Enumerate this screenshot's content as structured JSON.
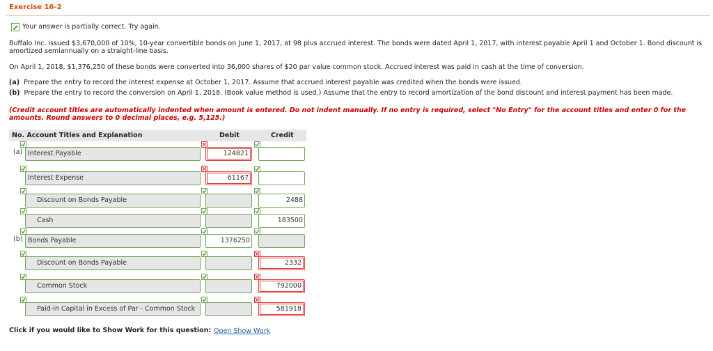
{
  "exercise_title": "Exercise 16-2",
  "status_text": "Your answer is partially correct.  Try again.",
  "problem_text": "Buffalo Inc. issued $3,670,000 of 10%, 10-year convertible bonds on June 1, 2017, at 98 plus accrued interest. The bonds were dated April 1, 2017, with interest payable April 1 and October 1. Bond discount is amortized semiannually on a straight-line basis.",
  "conversion_text": "On April 1, 2018, $1,376,250 of these bonds were converted into 36,000 shares of $20 par value common stock. Accrued interest was paid in cash at the time of conversion.",
  "part_a": {
    "label": "(a)",
    "text": "Prepare the entry to record the interest expense at October 1, 2017. Assume that accrued interest payable was credited when the bonds were issued."
  },
  "part_b": {
    "label": "(b)",
    "text": "Prepare the entry to record the conversion on April 1, 2018. (Book value method is used.) Assume that the entry to record amortization of the bond discount and interest payment has been made."
  },
  "instructions": "(Credit account titles are automatically indented when amount is entered. Do not indent manually. If no entry is required, select \"No Entry\" for the account titles and enter 0 for the amounts. Round answers to 0 decimal places, e.g. 5,125.)",
  "table_header": {
    "account": "No. Account Titles and Explanation",
    "debit": "Debit",
    "credit": "Credit"
  },
  "rows": [
    {
      "part": "(a)",
      "account": "Interest Payable",
      "debit": "124821",
      "credit": ""
    },
    {
      "part": "",
      "account": "Interest Expense",
      "debit": "61167",
      "credit": ""
    },
    {
      "part": "",
      "account": "Discount on Bonds Payable",
      "debit": "",
      "credit": "2488"
    },
    {
      "part": "",
      "account": "Cash",
      "debit": "",
      "credit": "183500"
    },
    {
      "part": "(b)",
      "account": "Bonds Payable",
      "debit": "1376250",
      "credit": ""
    },
    {
      "part": "",
      "account": "Discount on Bonds Payable",
      "debit": "",
      "credit": "2332"
    },
    {
      "part": "",
      "account": "Common Stock",
      "debit": "",
      "credit": "792000"
    },
    {
      "part": "",
      "account": "Paid-in Capital in Excess of Par - Common Stock",
      "debit": "",
      "credit": "581918"
    }
  ],
  "show_work_prompt": "Click if you would like to Show Work for this question:",
  "show_work_link": "Open Show Work",
  "colors": {
    "title": "#d24b00",
    "correct": "#6fa35a",
    "incorrect": "#e03a3a",
    "note": "#cc0000",
    "link": "#1f5fa8"
  },
  "icons": {
    "correct": "check-icon",
    "incorrect": "x-icon",
    "status": "pencil-check-icon"
  }
}
